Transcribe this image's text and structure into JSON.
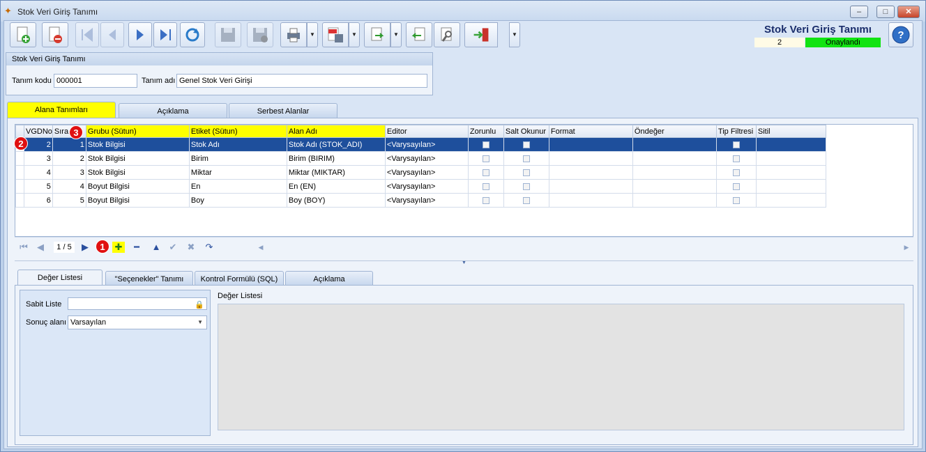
{
  "window": {
    "title": "Stok Veri Giriş Tanımı",
    "min": "–",
    "max": "□",
    "close": "✕"
  },
  "header": {
    "title": "Stok Veri Giriş Tanımı",
    "status_number": "2",
    "status_text": "Onaylandı",
    "help_label": "?"
  },
  "toolbar": {
    "icons": [
      "new-document-icon",
      "delete-document-icon",
      "first-record-icon",
      "previous-record-icon",
      "next-record-icon",
      "last-record-icon",
      "refresh-icon",
      "save-icon",
      "save-close-icon",
      "print-icon",
      "pdf-export-icon",
      "export-icon",
      "import-icon",
      "settings-icon",
      "exit-icon"
    ]
  },
  "definition": {
    "group_title": "Stok Veri Giriş Tanımı",
    "code_label": "Tanım kodu",
    "code_value": "000001",
    "name_label": "Tanım adı",
    "name_value": "Genel Stok Veri Girişi"
  },
  "tabs": [
    "Alana Tanımları",
    "Açıklama",
    "Serbest Alanlar"
  ],
  "grid": {
    "columns": [
      "VGDNo",
      "Sıra",
      "Grubu (Sütun)",
      "Etiket (Sütun)",
      "Alan Adı",
      "Editor",
      "Zorunlu",
      "Salt Okunur",
      "Format",
      "Öndeğer",
      "Tip Filtresi",
      "Sitil"
    ],
    "rows": [
      {
        "vgdno": "2",
        "sira": "1",
        "grubu": "Stok Bilgisi",
        "etiket": "Stok Adı",
        "alan": "Stok Adı (STOK_ADI)",
        "editor": "<Varysayılan>"
      },
      {
        "vgdno": "3",
        "sira": "2",
        "grubu": "Stok Bilgisi",
        "etiket": "Birim",
        "alan": "Birim (BIRIM)",
        "editor": "<Varysayılan>"
      },
      {
        "vgdno": "4",
        "sira": "3",
        "grubu": "Stok Bilgisi",
        "etiket": "Miktar",
        "alan": "Miktar (MIKTAR)",
        "editor": "<Varysayılan>"
      },
      {
        "vgdno": "5",
        "sira": "4",
        "grubu": "Boyut Bilgisi",
        "etiket": "En",
        "alan": "En (EN)",
        "editor": "<Varysayılan>"
      },
      {
        "vgdno": "6",
        "sira": "5",
        "grubu": "Boyut Bilgisi",
        "etiket": "Boy",
        "alan": "Boy (BOY)",
        "editor": "<Varysayılan>"
      }
    ]
  },
  "navigator": {
    "position": "1 / 5",
    "first": "⏮",
    "prev": "◀",
    "next": "▶",
    "add": "✚",
    "remove": "━",
    "up": "▲",
    "confirm": "✔",
    "cancel": "✖",
    "redo": "↷",
    "scroll_left": "◀",
    "scroll_right": "▶"
  },
  "badges": [
    "1",
    "2",
    "3"
  ],
  "bottom_tabs": [
    "Değer Listesi",
    "\"Seçenekler\" Tanımı",
    "Kontrol Formülü (SQL)",
    "Açıklama"
  ],
  "value_list": {
    "fixed_list_label": "Sabit Liste",
    "result_field_label": "Sonuç alanı",
    "result_field_value": "Varsayılan",
    "list_title": "Değer Listesi"
  },
  "colors": {
    "accent": "#ffff00",
    "status_ok": "#12e312",
    "selection": "#1e4f9c",
    "badge": "#e01010"
  }
}
